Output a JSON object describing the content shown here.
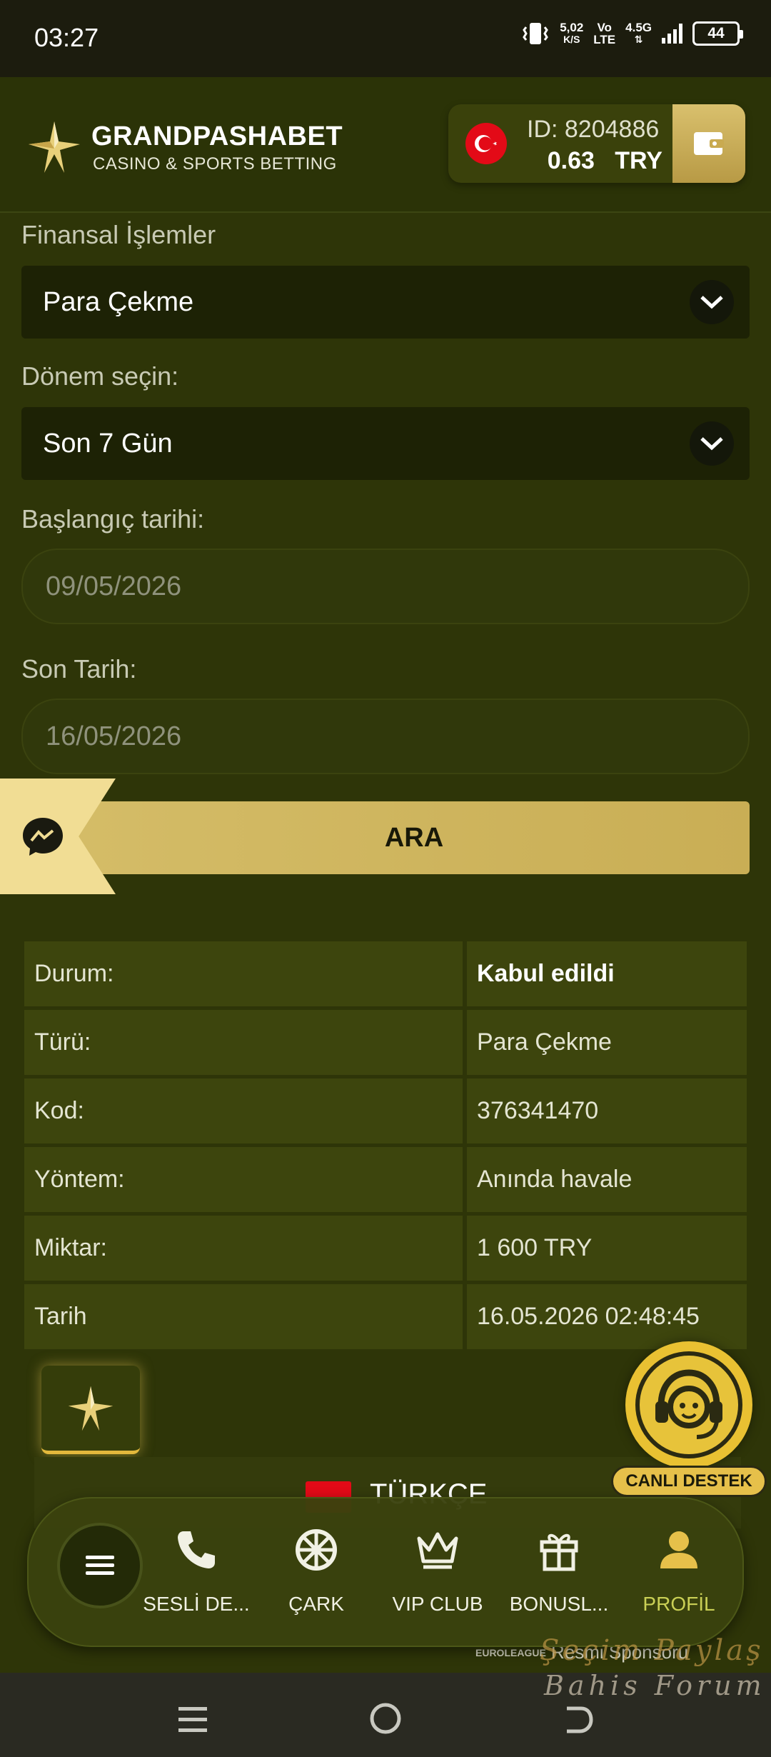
{
  "status_bar": {
    "time": "03:27",
    "net_speed": "5,02",
    "net_unit": "K/S",
    "volte_top": "Vo",
    "volte_bottom": "LTE",
    "network": "4.5G",
    "battery": "44"
  },
  "header": {
    "brand_name": "GRANDPASHABET",
    "brand_subtitle": "CASINO & SPORTS BETTING",
    "account_id": "ID: 8204886",
    "balance": "0.63",
    "currency": "TRY"
  },
  "form": {
    "financial_label": "Finansal İşlemler",
    "financial_value": "Para Çekme",
    "period_label": "Dönem seçin:",
    "period_value": "Son 7 Gün",
    "start_label": "Başlangıç tarihi:",
    "start_value": "09/05/2026",
    "end_label": "Son Tarih:",
    "end_value": "16/05/2026",
    "search_label": "ARA"
  },
  "transaction": {
    "rows": [
      {
        "key": "Durum:",
        "value": "Kabul edildi"
      },
      {
        "key": "Türü:",
        "value": "Para Çekme"
      },
      {
        "key": "Kod:",
        "value": "376341470"
      },
      {
        "key": "Yöntem:",
        "value": "Anında havale"
      },
      {
        "key": "Miktar:",
        "value": "1 600 TRY"
      },
      {
        "key": "Tarih",
        "value": "16.05.2026 02:48:45"
      }
    ]
  },
  "language": {
    "label": "TÜRKÇE"
  },
  "support": {
    "label": "CANLI DESTEK"
  },
  "nav": {
    "items": [
      {
        "label": "SESLİ DE...",
        "icon": "phone-icon"
      },
      {
        "label": "ÇARK",
        "icon": "wheel-icon"
      },
      {
        "label": "VIP CLUB",
        "icon": "crown-icon"
      },
      {
        "label": "BONUSL...",
        "icon": "gift-icon"
      },
      {
        "label": "PROFİL",
        "icon": "user-icon"
      }
    ]
  },
  "footer": {
    "league": "EUROLEAGUE",
    "sponsor": "Resmi Sponsoru",
    "watermark_1": "Şeçim Paylaş",
    "watermark_2": "Bahis Forum"
  },
  "colors": {
    "background": "#2e3508",
    "accent_gold": "#d4bc67",
    "active_nav": "#c9cf55"
  }
}
